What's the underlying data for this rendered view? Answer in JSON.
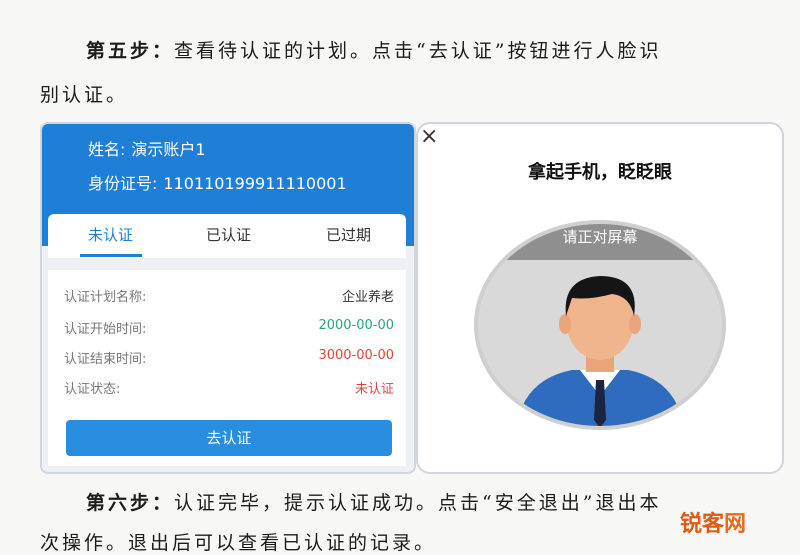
{
  "doc": {
    "step5_label": "第五步：",
    "step5_text": "查看待认证的计划。点击“去认证”按钮进行人脸识",
    "step5_cont": "别认证。",
    "step6_label": "第六步：",
    "step6_text": "认证完毕，提示认证成功。点击“安全退出”退出本",
    "step6_cont": "次操作。退出后可以查看已认证的记录。"
  },
  "account": {
    "name_label": "姓名:",
    "name_value": "演示账户1",
    "id_label": "身份证号:",
    "id_value": "110110199911110001"
  },
  "tabs": [
    {
      "label": "未认证",
      "active": true
    },
    {
      "label": "已认证",
      "active": false
    },
    {
      "label": "已过期",
      "active": false
    }
  ],
  "details": [
    {
      "key": "认证计划名称:",
      "value": "企业养老",
      "color": "#333333"
    },
    {
      "key": "认证开始时间:",
      "value": "2000-00-00",
      "color": "#2aa57a"
    },
    {
      "key": "认证结束时间:",
      "value": "3000-00-00",
      "color": "#e0453a"
    },
    {
      "key": "认证状态:",
      "value": "未认证",
      "color": "#e0453a"
    }
  ],
  "action_button": "去认证",
  "face": {
    "close_icon": "×",
    "title": "拿起手机，眨眨眼",
    "hint": "请正对屏幕"
  },
  "watermark": {
    "text_a": "锐客",
    "text_b": "网"
  },
  "colors": {
    "header_blue": "#1f7fd6",
    "button_blue": "#2a8ee0"
  }
}
